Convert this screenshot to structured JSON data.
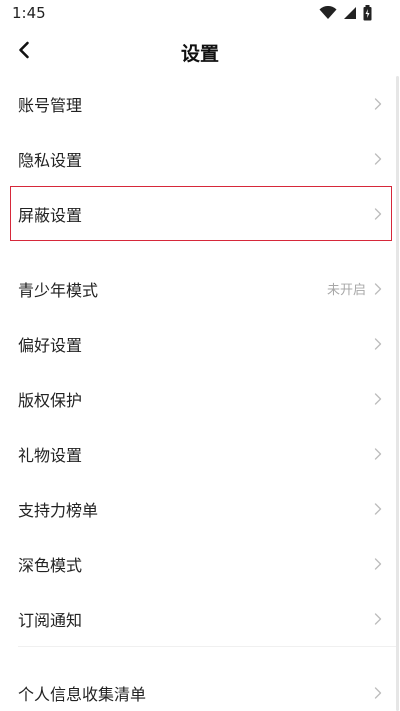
{
  "status_bar": {
    "time": "1:45",
    "icons": [
      "wifi-icon",
      "signal-icon",
      "battery-icon"
    ]
  },
  "header": {
    "title": "设置",
    "back_icon": "chevron-left-icon"
  },
  "sections": [
    {
      "items": [
        {
          "label": "账号管理",
          "value": ""
        },
        {
          "label": "隐私设置",
          "value": ""
        },
        {
          "label": "屏蔽设置",
          "value": "",
          "highlighted": true
        }
      ]
    },
    {
      "items": [
        {
          "label": "青少年模式",
          "value": "未开启"
        },
        {
          "label": "偏好设置",
          "value": ""
        },
        {
          "label": "版权保护",
          "value": ""
        },
        {
          "label": "礼物设置",
          "value": ""
        },
        {
          "label": "支持力榜单",
          "value": ""
        },
        {
          "label": "深色模式",
          "value": ""
        },
        {
          "label": "订阅通知",
          "value": ""
        }
      ]
    },
    {
      "items": [
        {
          "label": "个人信息收集清单",
          "value": ""
        }
      ]
    }
  ],
  "colors": {
    "highlight_border": "#d6283a",
    "chevron": "#bdbdbd",
    "secondary_text": "#a8a8a8"
  }
}
